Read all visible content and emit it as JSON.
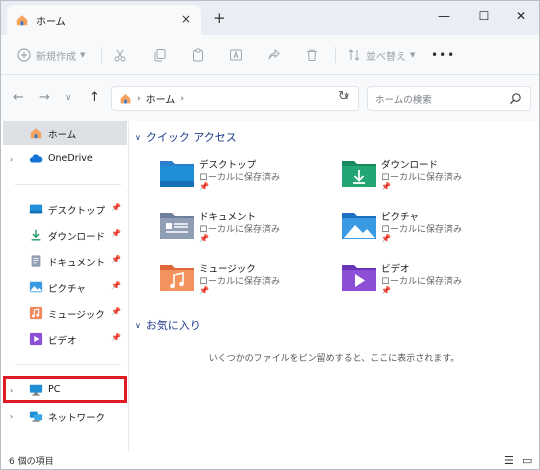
{
  "window": {
    "tab_title": "ホーム",
    "tab_close": "×",
    "new_tab": "+",
    "minimize": "—",
    "maximize": "☐",
    "close": "✕"
  },
  "toolbar": {
    "new_label": "新規作成",
    "sort_label": "並べ替え",
    "more_label": "•••"
  },
  "address": {
    "crumb": "ホーム",
    "search_placeholder": "ホームの検索"
  },
  "sidebar": {
    "items": [
      {
        "label": "ホーム"
      },
      {
        "label": "OneDrive"
      },
      {
        "label": "デスクトップ"
      },
      {
        "label": "ダウンロード"
      },
      {
        "label": "ドキュメント"
      },
      {
        "label": "ピクチャ"
      },
      {
        "label": "ミュージック"
      },
      {
        "label": "ビデオ"
      },
      {
        "label": "PC"
      },
      {
        "label": "ネットワーク"
      }
    ]
  },
  "main": {
    "quick_access_title": "クイック アクセス",
    "quick_access": [
      {
        "name": "デスクトップ",
        "sub": "ローカルに保存済み"
      },
      {
        "name": "ダウンロード",
        "sub": "ローカルに保存済み"
      },
      {
        "name": "ドキュメント",
        "sub": "ローカルに保存済み"
      },
      {
        "name": "ピクチャ",
        "sub": "ローカルに保存済み"
      },
      {
        "name": "ミュージック",
        "sub": "ローカルに保存済み"
      },
      {
        "name": "ビデオ",
        "sub": "ローカルに保存済み"
      }
    ],
    "favorites_title": "お気に入り",
    "favorites_empty": "いくつかのファイルをピン留めすると、ここに表示されます。"
  },
  "status": {
    "count": "6 個の項目"
  },
  "colors": {
    "highlight": "#e01b24",
    "section_title": "#1f3b8c",
    "folder_blue": "#1f8fd8"
  }
}
